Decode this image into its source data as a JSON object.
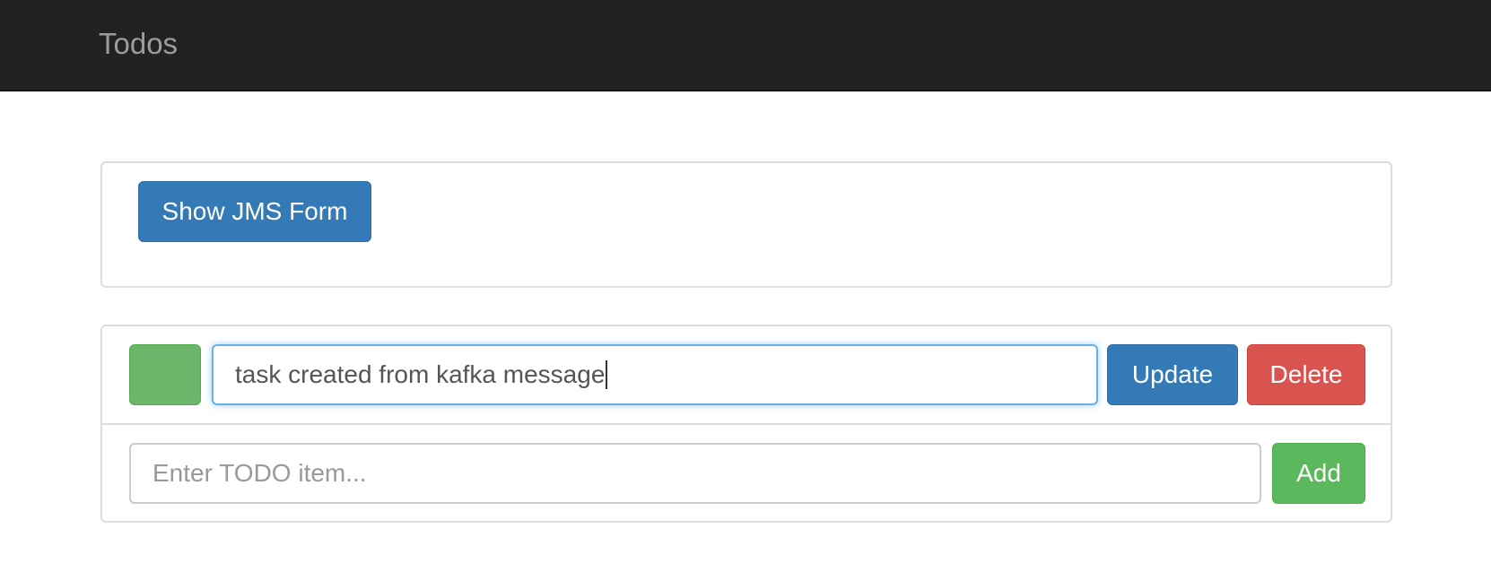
{
  "navbar": {
    "brand": "Todos",
    "background": "#222222",
    "brand_color": "#9d9d9d"
  },
  "jms_panel": {
    "show_jms_label": "Show JMS Form"
  },
  "todo_list": {
    "items": [
      {
        "text": "task created from kafka message",
        "done": true,
        "status_color": "#5cb85c",
        "update_label": "Update",
        "delete_label": "Delete"
      }
    ],
    "new_item": {
      "placeholder": "Enter TODO item...",
      "value": "",
      "add_label": "Add"
    }
  },
  "colors": {
    "primary": "#337ab7",
    "danger": "#d9534f",
    "success": "#5cb85c",
    "focus_border": "#66afe9"
  },
  "icons": {
    "done_toggle": "checkbox-toggle-icon"
  }
}
